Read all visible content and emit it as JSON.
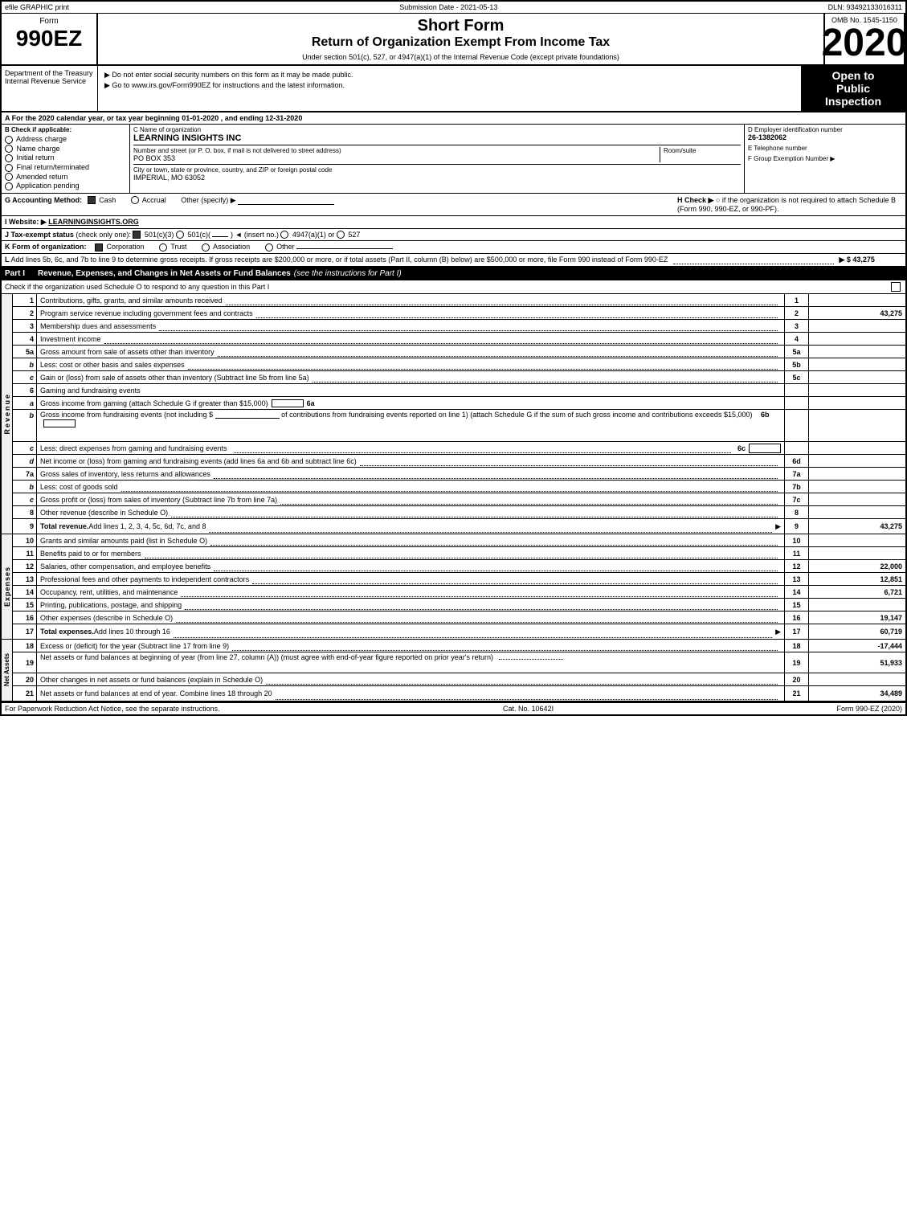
{
  "topBar": {
    "left": "efile GRAPHIC print",
    "center": "Submission Date - 2021-05-13",
    "right": "DLN: 93492133016311"
  },
  "header": {
    "formLabel": "Form",
    "formNumber": "990EZ",
    "title1": "Short Form",
    "title2": "Return of Organization Exempt From Income Tax",
    "subtitle": "Under section 501(c), 527, or 4947(a)(1) of the Internal Revenue Code (except private foundations)",
    "notice1": "▶ Do not enter social security numbers on this form as it may be made public.",
    "notice2": "▶ Go to www.irs.gov/Form990EZ for instructions and the latest information.",
    "year": "2020",
    "ombLabel": "OMB No. 1545-1150",
    "openLabel1": "Open to",
    "openLabel2": "Public",
    "openLabel3": "Inspection",
    "dept": "Department of the Treasury Internal Revenue Service"
  },
  "sectionA": {
    "text": "A  For the 2020 calendar year, or tax year beginning 01-01-2020 , and ending 12-31-2020"
  },
  "sectionB": {
    "checkLabel": "B  Check if applicable:",
    "addressChange": "Address charge",
    "nameChange": "Name charge",
    "initialReturn": "Initial return",
    "finalReturn": "Final return/terminated",
    "amendedReturn": "Amended return",
    "applicationPending": "Application pending",
    "nameLabel": "C Name of organization",
    "orgName": "LEARNING INSIGHTS INC",
    "numberLabel": "Number and street (or P. O. box, if mail is not delivered to street address)",
    "streetValue": "PO BOX 353",
    "roomLabel": "Room/suite",
    "roomValue": "",
    "cityLabel": "City or town, state or province, country, and ZIP or foreign postal code",
    "cityValue": "IMPERIAL, MO  63052",
    "einLabel": "D Employer identification number",
    "ein": "26-1382062",
    "phoneLabel": "E Telephone number",
    "phoneValue": "",
    "groupLabel": "F Group Exemption Number ▶",
    "groupValue": ""
  },
  "sectionG": {
    "label": "G Accounting Method:",
    "cashLabel": "Cash",
    "cashChecked": true,
    "accrualLabel": "Accrual",
    "accrualChecked": false,
    "otherLabel": "Other (specify) ▶",
    "hLabel": "H  Check ▶",
    "hText": "○ if the organization is not required to attach Schedule B (Form 990, 990-EZ, or 990-PF)."
  },
  "sectionI": {
    "label": "I Website: ▶",
    "value": "LEARNINGINSIGHTS.ORG"
  },
  "sectionJ": {
    "text": "J Tax-exempt status (check only one): ☑ 501(c)(3) ○ 501(c)(   ) ◄ (insert no.) ○ 4947(a)(1) or ○ 527"
  },
  "sectionK": {
    "text": "K Form of organization: ☑ Corporation  ○ Trust  ○ Association  ○ Other"
  },
  "sectionL": {
    "text": "L Add lines 5b, 6c, and 7b to line 9 to determine gross receipts. If gross receipts are $200,000 or more, or if total assets (Part II, column (B) below) are $500,000 or more, file Form 990 instead of Form 990-EZ",
    "value": "▶ $ 43,275"
  },
  "partI": {
    "header": "Part I",
    "title": "Revenue, Expenses, and Changes in Net Assets or Fund Balances",
    "note": "(see the instructions for Part I)",
    "checkText": "Check if the organization used Schedule O to respond to any question in this Part I",
    "lines": [
      {
        "num": "1",
        "desc": "Contributions, gifts, grants, and similar amounts received",
        "value": ""
      },
      {
        "num": "2",
        "desc": "Program service revenue including government fees and contracts",
        "value": "43,275"
      },
      {
        "num": "3",
        "desc": "Membership dues and assessments",
        "value": ""
      },
      {
        "num": "4",
        "desc": "Investment income",
        "value": ""
      }
    ],
    "line5": {
      "num": "5a",
      "desc": "Gross amount from sale of assets other than inventory",
      "subNum": "5a",
      "value": ""
    },
    "line5b": {
      "num": "b",
      "desc": "Less: cost or other basis and sales expenses",
      "subNum": "5b",
      "value": ""
    },
    "line5c": {
      "num": "c",
      "desc": "Gain or (loss) from sale of assets other than inventory (Subtract line 5b from line 5a)",
      "lineNum": "5c",
      "value": ""
    },
    "line6header": "6    Gaming and fundraising events",
    "line6a": {
      "desc": "Gross income from gaming (attach Schedule G if greater than $15,000)",
      "subNum": "6a",
      "value": ""
    },
    "line6b": {
      "desc": "Gross income from fundraising events (not including $",
      "desc2": "of contributions from fundraising events reported on line 1) (attach Schedule G if the sum of such gross income and contributions exceeds $15,000)",
      "subNum": "6b",
      "value": ""
    },
    "line6c": {
      "desc": "Less: direct expenses from gaming and fundraising events",
      "subNum": "6c",
      "value": ""
    },
    "line6d": {
      "desc": "Net income or (loss) from gaming and fundraising events (add lines 6a and 6b and subtract line 6c)",
      "lineNum": "6d",
      "value": ""
    },
    "line7a": {
      "desc": "Gross sales of inventory, less returns and allowances",
      "subNum": "7a",
      "value": ""
    },
    "line7b": {
      "desc": "Less: cost of goods sold",
      "subNum": "7b",
      "value": ""
    },
    "line7c": {
      "desc": "Gross profit or (loss) from sales of inventory (Subtract line 7b from line 7a)",
      "lineNum": "7c",
      "value": ""
    },
    "line8": {
      "num": "8",
      "desc": "Other revenue (describe in Schedule O)",
      "value": ""
    },
    "line9": {
      "num": "9",
      "desc": "Total revenue. Add lines 1, 2, 3, 4, 5c, 6d, 7c, and 8",
      "value": "43,275",
      "arrow": "▶"
    }
  },
  "expenses": {
    "lines": [
      {
        "num": "10",
        "desc": "Grants and similar amounts paid (list in Schedule O)",
        "value": ""
      },
      {
        "num": "11",
        "desc": "Benefits paid to or for members",
        "value": ""
      },
      {
        "num": "12",
        "desc": "Salaries, other compensation, and employee benefits",
        "value": "22,000"
      },
      {
        "num": "13",
        "desc": "Professional fees and other payments to independent contractors",
        "value": "12,851"
      },
      {
        "num": "14",
        "desc": "Occupancy, rent, utilities, and maintenance",
        "value": "6,721"
      },
      {
        "num": "15",
        "desc": "Printing, publications, postage, and shipping",
        "value": ""
      },
      {
        "num": "16",
        "desc": "Other expenses (describe in Schedule O)",
        "value": "19,147"
      },
      {
        "num": "17",
        "desc": "Total expenses. Add lines 10 through 16",
        "value": "60,719",
        "arrow": "▶"
      }
    ]
  },
  "netAssets": {
    "lines": [
      {
        "num": "18",
        "desc": "Excess or (deficit) for the year (Subtract line 17 from line 9)",
        "value": "-17,444"
      },
      {
        "num": "19",
        "desc": "Net assets or fund balances at beginning of year (from line 27, column (A)) (must agree with end-of-year figure reported on prior year's return)",
        "value": "51,933"
      },
      {
        "num": "20",
        "desc": "Other changes in net assets or fund balances (explain in Schedule O)",
        "value": ""
      },
      {
        "num": "21",
        "desc": "Net assets or fund balances at end of year. Combine lines 18 through 20",
        "value": "34,489"
      }
    ]
  },
  "footer": {
    "paperwork": "For Paperwork Reduction Act Notice, see the separate instructions.",
    "catNo": "Cat. No. 10642I",
    "formRef": "Form 990-EZ (2020)"
  }
}
